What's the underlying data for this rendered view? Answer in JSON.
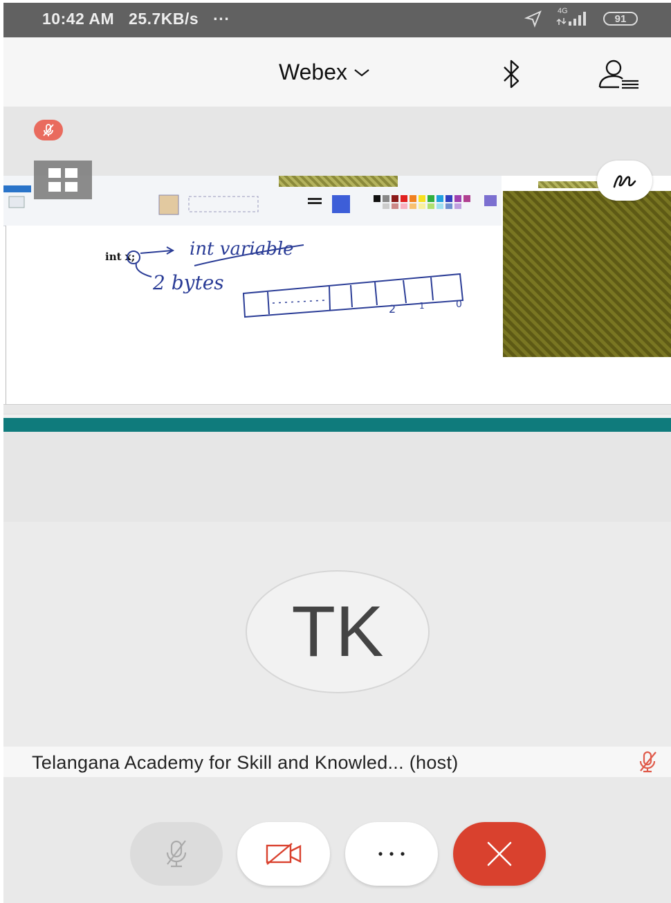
{
  "status_bar": {
    "time": "10:42 AM",
    "speed": "25.7KB/s",
    "dots": "···",
    "network": "4G",
    "battery": "91"
  },
  "header": {
    "title": "Webex"
  },
  "shared_screen": {
    "handwriting": {
      "code": "int x;",
      "note1": "int variable",
      "note2": "2 bytes",
      "bit_labels": [
        "2",
        "1",
        "0"
      ]
    }
  },
  "participant": {
    "initials": "TK",
    "name": "Telangana Academy for Skill and Knowled... (host)"
  },
  "colors": {
    "status_bar": "#616161",
    "mute_badge": "#e96b5e",
    "end_call": "#d9412e",
    "taskbar": "#0f7b7c"
  },
  "controls": {
    "mute": "mic-muted-icon",
    "video": "video-off-icon",
    "more": "more-icon",
    "end": "close-icon"
  }
}
